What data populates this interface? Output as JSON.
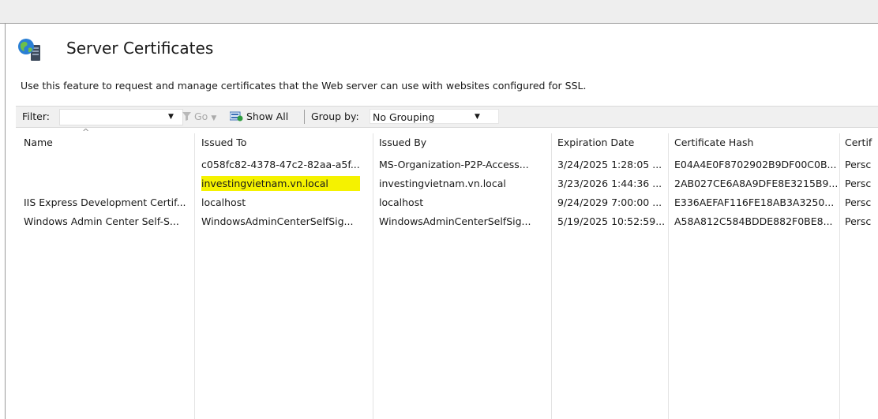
{
  "page": {
    "title": "Server Certificates",
    "description": "Use this feature to request and manage certificates that the Web server can use with websites configured for SSL."
  },
  "toolbar": {
    "filter_label": "Filter:",
    "filter_value": "",
    "go_label": "Go",
    "show_all_label": "Show All",
    "group_by_label": "Group by:",
    "group_by_value": "No Grouping"
  },
  "table": {
    "columns": [
      "Name",
      "Issued To",
      "Issued By",
      "Expiration Date",
      "Certificate Hash",
      "Certif"
    ],
    "rows": [
      [
        "",
        "c058fc82-4378-47c2-82aa-a5f...",
        "MS-Organization-P2P-Access...",
        "3/24/2025 1:28:05 ...",
        "E04A4E0F8702902B9DF00C0B...",
        "Persc"
      ],
      [
        "",
        "investingvietnam.vn.local",
        "investingvietnam.vn.local",
        "3/23/2026 1:44:36 ...",
        "2AB027CE6A8A9DFE8E3215B9...",
        "Persc"
      ],
      [
        "IIS Express Development Certif...",
        "localhost",
        "localhost",
        "9/24/2029 7:00:00 ...",
        "E336AEFAF116FE18AB3A3250...",
        "Persc"
      ],
      [
        "Windows Admin Center Self-S...",
        "WindowsAdminCenterSelfSig...",
        "WindowsAdminCenterSelfSig...",
        "5/19/2025 10:52:59...",
        "A58A812C584BDDE882F0BE8...",
        "Persc"
      ]
    ]
  },
  "colors": {
    "highlight": "#f5f200",
    "accent": "#2a6cc2"
  }
}
